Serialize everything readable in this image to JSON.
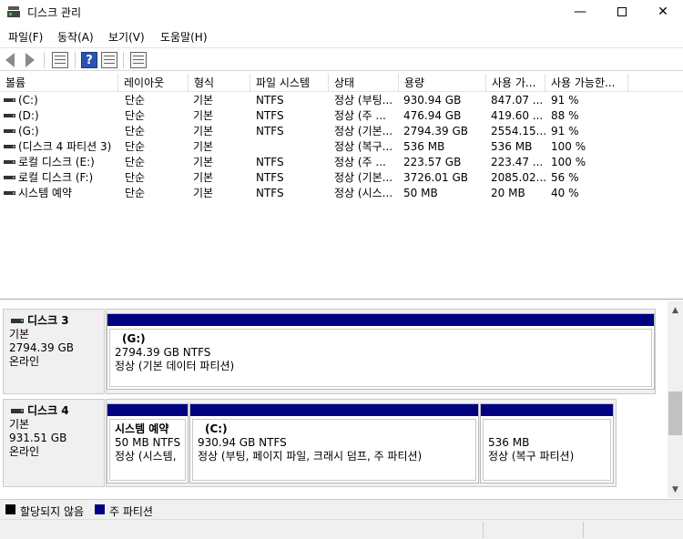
{
  "window": {
    "title": "디스크 관리",
    "min": "—",
    "close": "✕"
  },
  "menu": [
    "파일(F)",
    "동작(A)",
    "보기(V)",
    "도움말(H)"
  ],
  "columns": [
    "볼륨",
    "레이아웃",
    "형식",
    "파일 시스템",
    "상태",
    "용량",
    "사용 가...",
    "사용 가능한..."
  ],
  "volumes": [
    {
      "name": "(C:)",
      "layout": "단순",
      "type": "기본",
      "fs": "NTFS",
      "status": "정상 (부팅...",
      "capacity": "930.94 GB",
      "free": "847.07 ...",
      "pct": "91 %"
    },
    {
      "name": "(D:)",
      "layout": "단순",
      "type": "기본",
      "fs": "NTFS",
      "status": "정상 (주 ...",
      "capacity": "476.94 GB",
      "free": "419.60 ...",
      "pct": "88 %"
    },
    {
      "name": "(G:)",
      "layout": "단순",
      "type": "기본",
      "fs": "NTFS",
      "status": "정상 (기본...",
      "capacity": "2794.39 GB",
      "free": "2554.15...",
      "pct": "91 %"
    },
    {
      "name": "(디스크 4 파티션 3)",
      "layout": "단순",
      "type": "기본",
      "fs": "",
      "status": "정상 (복구...",
      "capacity": "536 MB",
      "free": "536 MB",
      "pct": "100 %"
    },
    {
      "name": "로컬 디스크 (E:)",
      "layout": "단순",
      "type": "기본",
      "fs": "NTFS",
      "status": "정상 (주 ...",
      "capacity": "223.57 GB",
      "free": "223.47 ...",
      "pct": "100 %"
    },
    {
      "name": "로컬 디스크 (F:)",
      "layout": "단순",
      "type": "기본",
      "fs": "NTFS",
      "status": "정상 (기본...",
      "capacity": "3726.01 GB",
      "free": "2085.02...",
      "pct": "56 %"
    },
    {
      "name": "시스템 예약",
      "layout": "단순",
      "type": "기본",
      "fs": "NTFS",
      "status": "정상 (시스...",
      "capacity": "50 MB",
      "free": "20 MB",
      "pct": "40 %"
    }
  ],
  "disks": [
    {
      "title": "디스크 3",
      "type": "기본",
      "size": "2794.39 GB",
      "state": "온라인",
      "partitions": [
        {
          "name": "(G:)",
          "size": "2794.39 GB NTFS",
          "status": "정상 (기본 데이터 파티션)"
        }
      ]
    },
    {
      "title": "디스크 4",
      "type": "기본",
      "size": "931.51 GB",
      "state": "온라인",
      "partitions": [
        {
          "name": "시스템 예약",
          "size": "50 MB NTFS",
          "status": "정상 (시스템,"
        },
        {
          "name": "(C:)",
          "size": "930.94 GB NTFS",
          "status": "정상 (부팅, 페이지 파일, 크래시 덤프, 주 파티션)"
        },
        {
          "name": "",
          "size": "536 MB",
          "status": "정상 (복구 파티션)"
        }
      ]
    }
  ],
  "legend": [
    {
      "label": "할당되지 않음",
      "color": "#000000"
    },
    {
      "label": "주 파티션",
      "color": "#000080"
    }
  ],
  "colors": {
    "primary_partition": "#000080",
    "unallocated": "#000000"
  }
}
